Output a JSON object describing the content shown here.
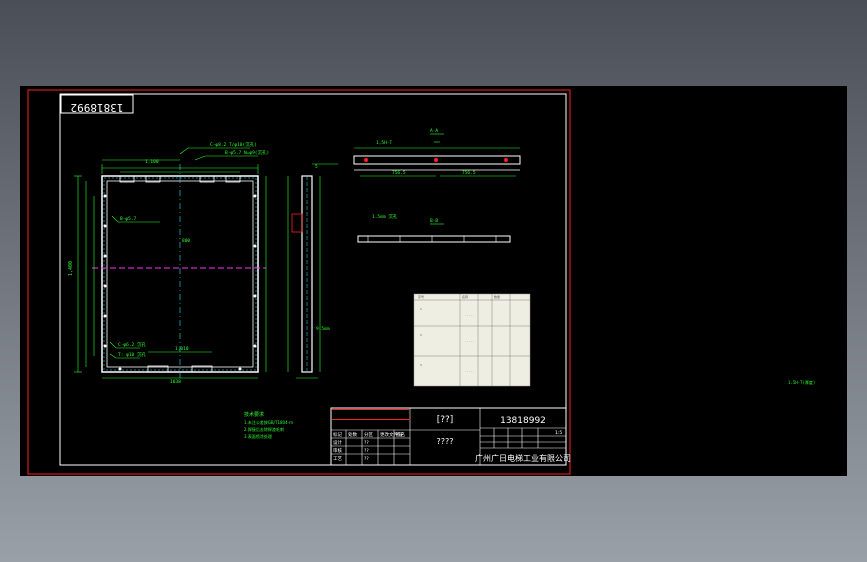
{
  "sheet": {
    "drawing_code_mirrored": "13818992",
    "drawing_code": "13818992",
    "title_box_top": "[??]",
    "title_box_mid": "????",
    "company": "广州广日电梯工业有限公司",
    "scale_text": "1:5",
    "section_label": "A-A",
    "view_label": "B-B",
    "table_headers": [
      "标记",
      "处数",
      "分区",
      "更改文件号",
      "签名",
      "年月日"
    ],
    "signers": [
      "设计",
      "审核",
      "工艺",
      "批准"
    ],
    "sign_values": [
      "??",
      "??",
      "??",
      "??"
    ],
    "tech_req_title": "技术要求",
    "tech_req_lines": [
      "1.未注公差按GB/T1804-m",
      "2.焊接后去除焊渣毛刺",
      "3.表面喷涂处理"
    ],
    "side_note": "1.5H-T(厚度)"
  },
  "colors": {
    "frame": "#ff2020",
    "line": "#ffffff",
    "dim": "#2aff2a",
    "cyan": "#20e0ff",
    "magenta": "#ff30ff",
    "yellow": "#ffff40",
    "bom_bg": "#efeee2"
  }
}
